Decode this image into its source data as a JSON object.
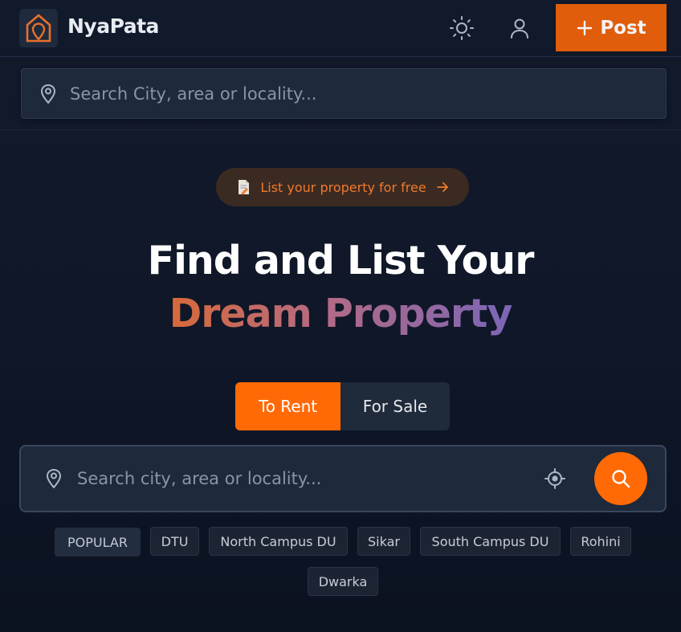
{
  "header": {
    "brand": "NyaPata",
    "post_label": "Post"
  },
  "top_search": {
    "placeholder": "Search City, area or locality..."
  },
  "badge": {
    "label": "List your property for free"
  },
  "hero": {
    "line1": "Find and List Your",
    "line2": "Dream Property"
  },
  "tabs": {
    "rent": "To Rent",
    "sale": "For Sale"
  },
  "main_search": {
    "placeholder": "Search city, area or locality..."
  },
  "tags": {
    "popular": "POPULAR",
    "items": [
      "DTU",
      "North Campus DU",
      "Sikar",
      "South Campus DU",
      "Rohini",
      "Dwarka"
    ]
  },
  "colors": {
    "accent": "#ff6a06",
    "post_button": "#e05d0b",
    "background": "#111a2b",
    "panel": "#1e293b",
    "gradient_start": "#d86a3a",
    "gradient_end": "#7c66b8"
  },
  "icons": {
    "logo": "house-pin-icon",
    "theme": "sun-icon",
    "account": "user-icon",
    "post": "plus-icon",
    "location": "map-pin-icon",
    "badge": "document-icon",
    "arrow": "arrow-right-icon",
    "locate": "crosshair-icon",
    "search": "search-icon"
  }
}
